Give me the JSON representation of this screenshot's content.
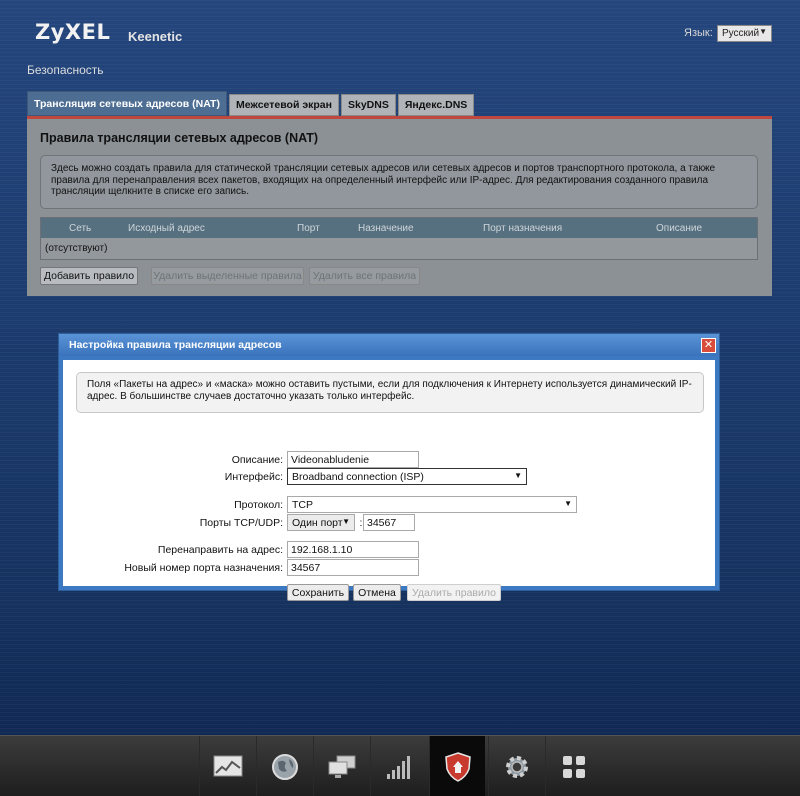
{
  "header": {
    "logo": "ZyXEL",
    "product": "Keenetic",
    "language_label": "Язык:",
    "language_value": "Русский"
  },
  "section_title": "Безопасность",
  "tabs": [
    {
      "label": "Трансляция сетевых адресов (NAT)",
      "active": true
    },
    {
      "label": "Межсетевой экран",
      "active": false
    },
    {
      "label": "SkyDNS",
      "active": false
    },
    {
      "label": "Яндекс.DNS",
      "active": false
    }
  ],
  "nat_panel": {
    "title": "Правила трансляции сетевых адресов (NAT)",
    "info": "Здесь можно создать правила для статической трансляции сетевых адресов или сетевых адресов и портов транспортного протокола, а также правила для перенаправления всех пакетов, входящих на определенный интерфейс или IP-адрес. Для редактирования созданного правила трансляции щелкните в списке его запись.",
    "columns": [
      "Сеть",
      "Исходный адрес",
      "Порт",
      "Назначение",
      "Порт назначения",
      "Описание"
    ],
    "empty_text": "(отсутствуют)",
    "buttons": {
      "add": "Добавить правило",
      "delete_selected": "Удалить выделенные правила",
      "delete_all": "Удалить все правила"
    }
  },
  "dialog": {
    "title": "Настройка правила трансляции адресов",
    "info": "Поля «Пакеты на адрес» и «маска» можно оставить пустыми, если для подключения к Интернету используется динамический IP-адрес. В большинстве случаев достаточно указать только интерфейс.",
    "fields": {
      "description_label": "Описание:",
      "description_value": "Videonabludenie",
      "interface_label": "Интерфейс:",
      "interface_value": "Broadband connection (ISP)",
      "protocol_label": "Протокол:",
      "protocol_value": "TCP",
      "ports_label": "Порты TCP/UDP:",
      "ports_mode": "Один порт",
      "ports_separator": ":",
      "port_value": "34567",
      "redirect_label": "Перенаправить на адрес:",
      "redirect_value": "192.168.1.10",
      "dest_port_label": "Новый номер порта назначения:",
      "dest_port_value": "34567"
    },
    "buttons": {
      "save": "Сохранить",
      "cancel": "Отмена",
      "delete": "Удалить правило"
    }
  },
  "dock": [
    {
      "name": "monitor-chart-icon",
      "active": false
    },
    {
      "name": "globe-icon",
      "active": false
    },
    {
      "name": "network-computers-icon",
      "active": false
    },
    {
      "name": "wifi-signal-bars-icon",
      "active": false
    },
    {
      "name": "security-shield-icon",
      "active": true
    },
    {
      "name": "gear-icon",
      "active": false
    },
    {
      "name": "apps-grid-icon",
      "active": false
    }
  ]
}
